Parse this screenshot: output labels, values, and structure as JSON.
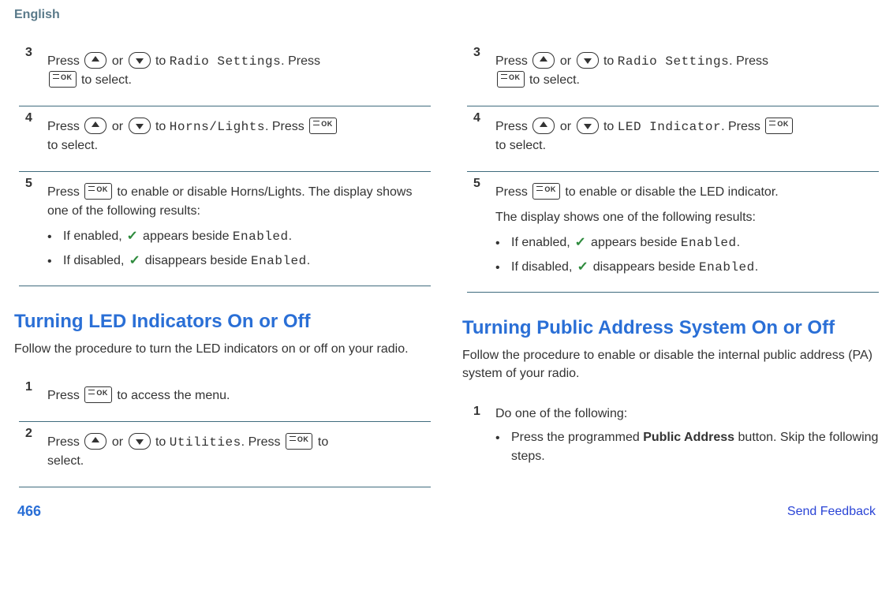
{
  "header": {
    "language": "English"
  },
  "footer": {
    "page": "466",
    "feedback": "Send Feedback"
  },
  "text": {
    "press": "Press",
    "or": "or",
    "to": "to",
    "to_select_period": "to select.",
    "period_press": ". Press",
    "to_enable_disable_hl": "to enable or disable Horns/Lights. The display shows one of the following results:",
    "to_enable_disable_led": "to enable or disable the LED indicator.",
    "display_results": "The display shows one of the following results:",
    "if_enabled_pre": "If enabled,",
    "appears_beside": "appears beside",
    "if_disabled_pre": "If disabled,",
    "disappears_beside": "disappears beside",
    "enabled_label": "Enabled",
    "to_access_menu": "to access the menu.",
    "to_after": "to",
    "select_period": "select.",
    "do_one": "Do one of the following:",
    "press_programmed": "Press the programmed",
    "public_address": "Public Address",
    "button_skip": "button. Skip the following steps."
  },
  "mono": {
    "radio_settings": "Radio Settings",
    "horns_lights": "Horns/Lights",
    "led_indicator": "LED Indicator",
    "utilities": "Utilities"
  },
  "sections": {
    "led": {
      "title": "Turning LED Indicators On or Off",
      "intro": "Follow the procedure to turn the LED indicators on or off on your radio."
    },
    "pa": {
      "title": "Turning Public Address System On or Off",
      "intro": "Follow the procedure to enable or disable the internal public address (PA) system of your radio."
    }
  },
  "nums": {
    "n1": "1",
    "n2": "2",
    "n3": "3",
    "n4": "4",
    "n5": "5"
  },
  "bullet": "•"
}
